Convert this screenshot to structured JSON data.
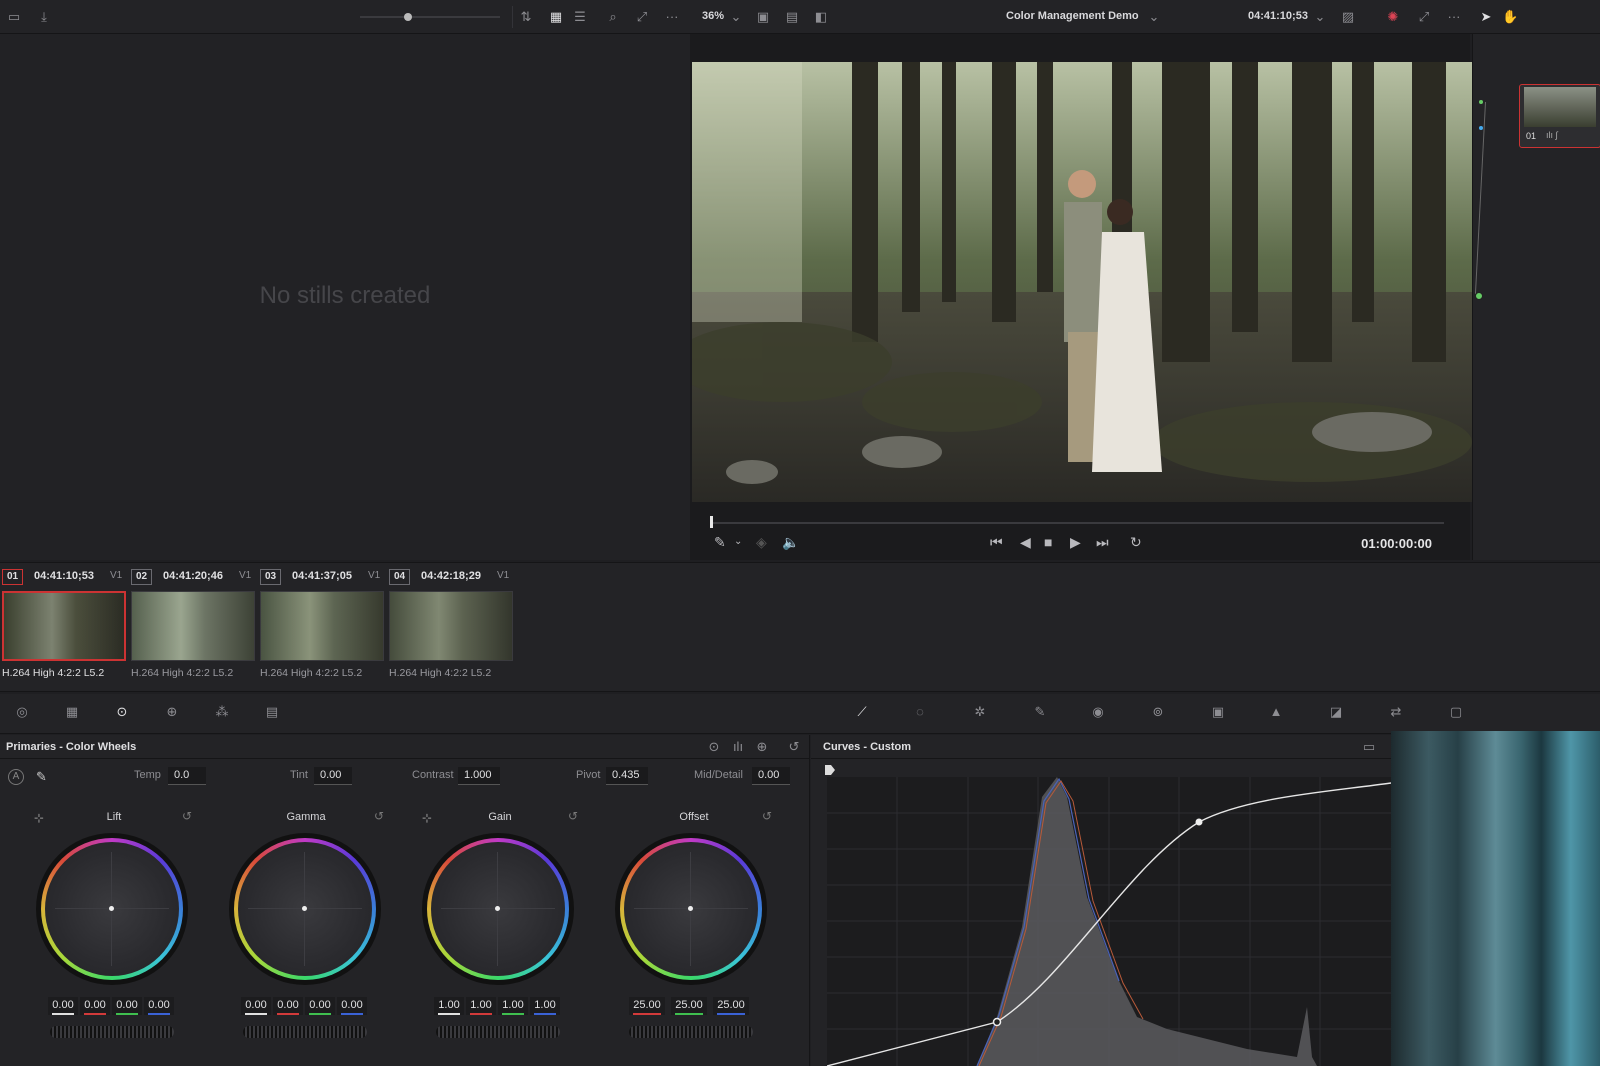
{
  "toolbar": {
    "zoom": "36%",
    "project_title": "Color Management Demo",
    "timecode": "04:41:10;53",
    "ellipsis": "···"
  },
  "gallery": {
    "empty_message": "No stills created"
  },
  "viewer": {
    "timecode": "01:00:00:00",
    "playhead_fraction": 0.02
  },
  "node_editor": {
    "node_label": "01"
  },
  "clips": [
    {
      "num": "01",
      "timecode": "04:41:10;53",
      "track": "V1",
      "codec": "H.264 High 4:2:2 L5.2",
      "active": true
    },
    {
      "num": "02",
      "timecode": "04:41:20;46",
      "track": "V1",
      "codec": "H.264 High 4:2:2 L5.2",
      "active": false
    },
    {
      "num": "03",
      "timecode": "04:41:37;05",
      "track": "V1",
      "codec": "H.264 High 4:2:2 L5.2",
      "active": false
    },
    {
      "num": "04",
      "timecode": "04:42:18;29",
      "track": "V1",
      "codec": "H.264 High 4:2:2 L5.2",
      "active": false
    }
  ],
  "primaries": {
    "title": "Primaries - Color Wheels",
    "auto_badge": "A",
    "temp_label": "Temp",
    "temp": "0.0",
    "tint_label": "Tint",
    "tint": "0.00",
    "contrast_label": "Contrast",
    "contrast": "1.000",
    "pivot_label": "Pivot",
    "pivot": "0.435",
    "middetail_label": "Mid/Detail",
    "middetail": "0.00",
    "wheels": [
      {
        "label": "Lift",
        "values": [
          "0.00",
          "0.00",
          "0.00",
          "0.00"
        ]
      },
      {
        "label": "Gamma",
        "values": [
          "0.00",
          "0.00",
          "0.00",
          "0.00"
        ]
      },
      {
        "label": "Gain",
        "values": [
          "1.00",
          "1.00",
          "1.00",
          "1.00"
        ]
      },
      {
        "label": "Offset",
        "values": [
          "25.00",
          "25.00",
          "25.00"
        ]
      }
    ]
  },
  "curves": {
    "title": "Curves - Custom"
  },
  "colors": {
    "accent_red": "#cc3333",
    "channel_white": "#e0e0e0",
    "channel_red": "#d23a3a",
    "channel_green": "#3fbf4f",
    "channel_blue": "#3a62d6"
  },
  "icons": [
    "sidebar-icon",
    "import-icon",
    "sort-icon",
    "grid-view-icon",
    "list-view-icon",
    "search-icon",
    "fullscreen-icon",
    "more-icon",
    "viewer-mode-icon",
    "cursor-icon",
    "hand-icon",
    "eyedropper-icon",
    "volume-icon",
    "skip-back-icon",
    "step-back-icon",
    "stop-icon",
    "play-icon",
    "skip-forward-icon",
    "loop-icon",
    "curves-icon",
    "reset-icon"
  ]
}
